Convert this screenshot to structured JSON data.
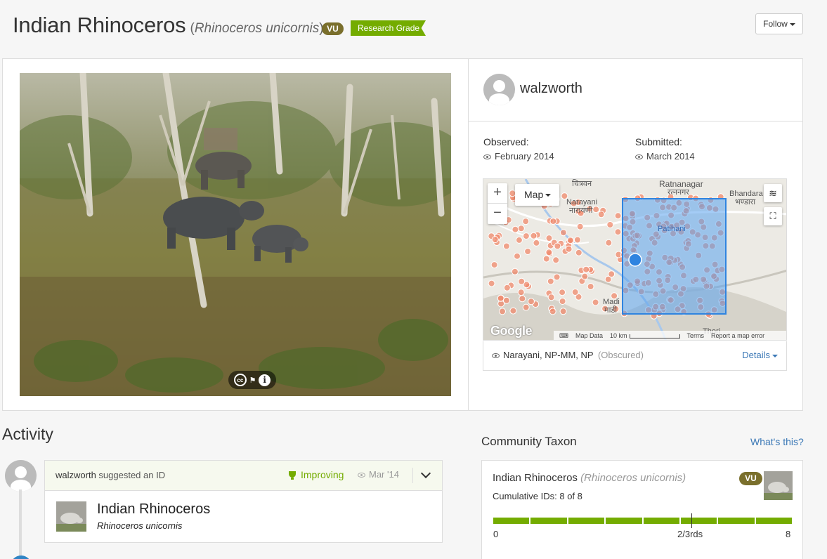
{
  "header": {
    "common_name": "Indian Rhinoceros",
    "sci_open": "(",
    "scientific_name": "Rhinoceros unicornis",
    "sci_close": ")",
    "status_badge": "VU",
    "quality_grade": "Research Grade",
    "follow_label": "Follow"
  },
  "photo": {
    "license_icon": "cc-icon",
    "flag_icon": "flag-icon",
    "info_icon": "info-icon"
  },
  "observer": {
    "username": "walzworth"
  },
  "dates": {
    "observed_label": "Observed:",
    "observed_value": "February 2014",
    "submitted_label": "Submitted:",
    "submitted_value": "March 2014"
  },
  "map": {
    "type_label": "Map",
    "zoom_in": "+",
    "zoom_out": "−",
    "labels": {
      "ratnanagar": "Ratnanagar",
      "ratnanagar_local": "रत्ननगर",
      "bhandara": "Bhandara",
      "bhandara_local": "भण्डारा",
      "narayani": "Narayani",
      "narayani_local": "नारायणी",
      "chitwan_local": "चित्रवन",
      "patihani": "Patihani",
      "madi": "Madi",
      "madi_local": "माडी",
      "thori": "Thori"
    },
    "google_logo": "Google",
    "footer": {
      "map_data": "Map Data",
      "scale": "10 km",
      "terms": "Terms",
      "report": "Report a map error"
    },
    "colors": {
      "obscured_box": "#5aa3ef",
      "markers": "#f08a6c"
    }
  },
  "place": {
    "name": "Narayani, NP-MM, NP",
    "obscured": "(Obscured)",
    "details_label": "Details"
  },
  "activity": {
    "title": "Activity",
    "item": {
      "user": "walzworth",
      "action": "suggested an ID",
      "status": "Improving",
      "date": "Mar '14",
      "taxon_common": "Indian Rhinoceros",
      "taxon_sci": "Rhinoceros unicornis"
    }
  },
  "community_taxon": {
    "title": "Community Taxon",
    "help_link": "What's this?",
    "common_name": "Indian Rhinoceros",
    "scientific_name": "(Rhinoceros unicornis)",
    "status_badge": "VU",
    "cumulative": "Cumulative IDs: 8 of 8",
    "scale_min": "0",
    "scale_mid": "2/3rds",
    "scale_max": "8",
    "ids_agreeing": 8,
    "ids_total": 8,
    "accent": "#74ac00"
  }
}
